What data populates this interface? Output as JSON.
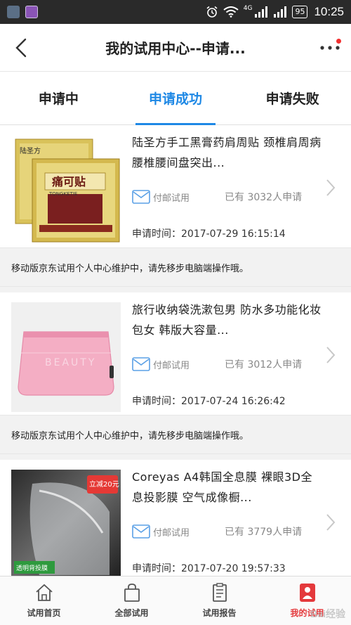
{
  "status_bar": {
    "network": "4G",
    "battery": "95",
    "time": "10:25"
  },
  "header": {
    "title": "我的试用中心--申请..."
  },
  "tabs": [
    {
      "label": "申请中",
      "active": false
    },
    {
      "label": "申请成功",
      "active": true
    },
    {
      "label": "申请失败",
      "active": false
    }
  ],
  "colors": {
    "accent": "#1e88e5",
    "active_nav": "#e4393c",
    "notice_bg": "#f2f2f2"
  },
  "items": [
    {
      "title": "陆圣方手工黑膏药肩周贴 颈椎肩周病腰椎腰间盘突出...",
      "mail_label": "付邮试用",
      "applied": "已有 3032人申请",
      "time": "申请时间：2017-07-29 16:15:14",
      "image_texts": {
        "brand": "陆圣方",
        "product": "痛可贴",
        "product_en": "TONGKETIE"
      }
    },
    {
      "title": "旅行收纳袋洗漱包男 防水多功能化妆包女 韩版大容量...",
      "mail_label": "付邮试用",
      "applied": "已有 3012人申请",
      "time": "申请时间：2017-07-24 16:26:42",
      "image_texts": {
        "bag_text": "BEAUTY"
      }
    },
    {
      "title": "Coreyas A4韩国全息膜 裸眼3D全息投影膜 空气成像橱...",
      "mail_label": "付邮试用",
      "applied": "已有 3779人申请",
      "time": "申请时间：2017-07-20 19:57:33",
      "image_texts": {
        "promo": "立减20元",
        "tag": "透明背投膜"
      }
    }
  ],
  "notice": "移动版京东试用个人中心维护中，请先移步电脑端操作哦。",
  "bottom_nav": [
    {
      "label": "试用首页",
      "icon": "home-icon",
      "active": false
    },
    {
      "label": "全部试用",
      "icon": "bag-icon",
      "active": false
    },
    {
      "label": "试用报告",
      "icon": "report-icon",
      "active": false
    },
    {
      "label": "我的试用",
      "icon": "my-trial-icon",
      "active": true
    }
  ],
  "watermark": "Bai经验"
}
